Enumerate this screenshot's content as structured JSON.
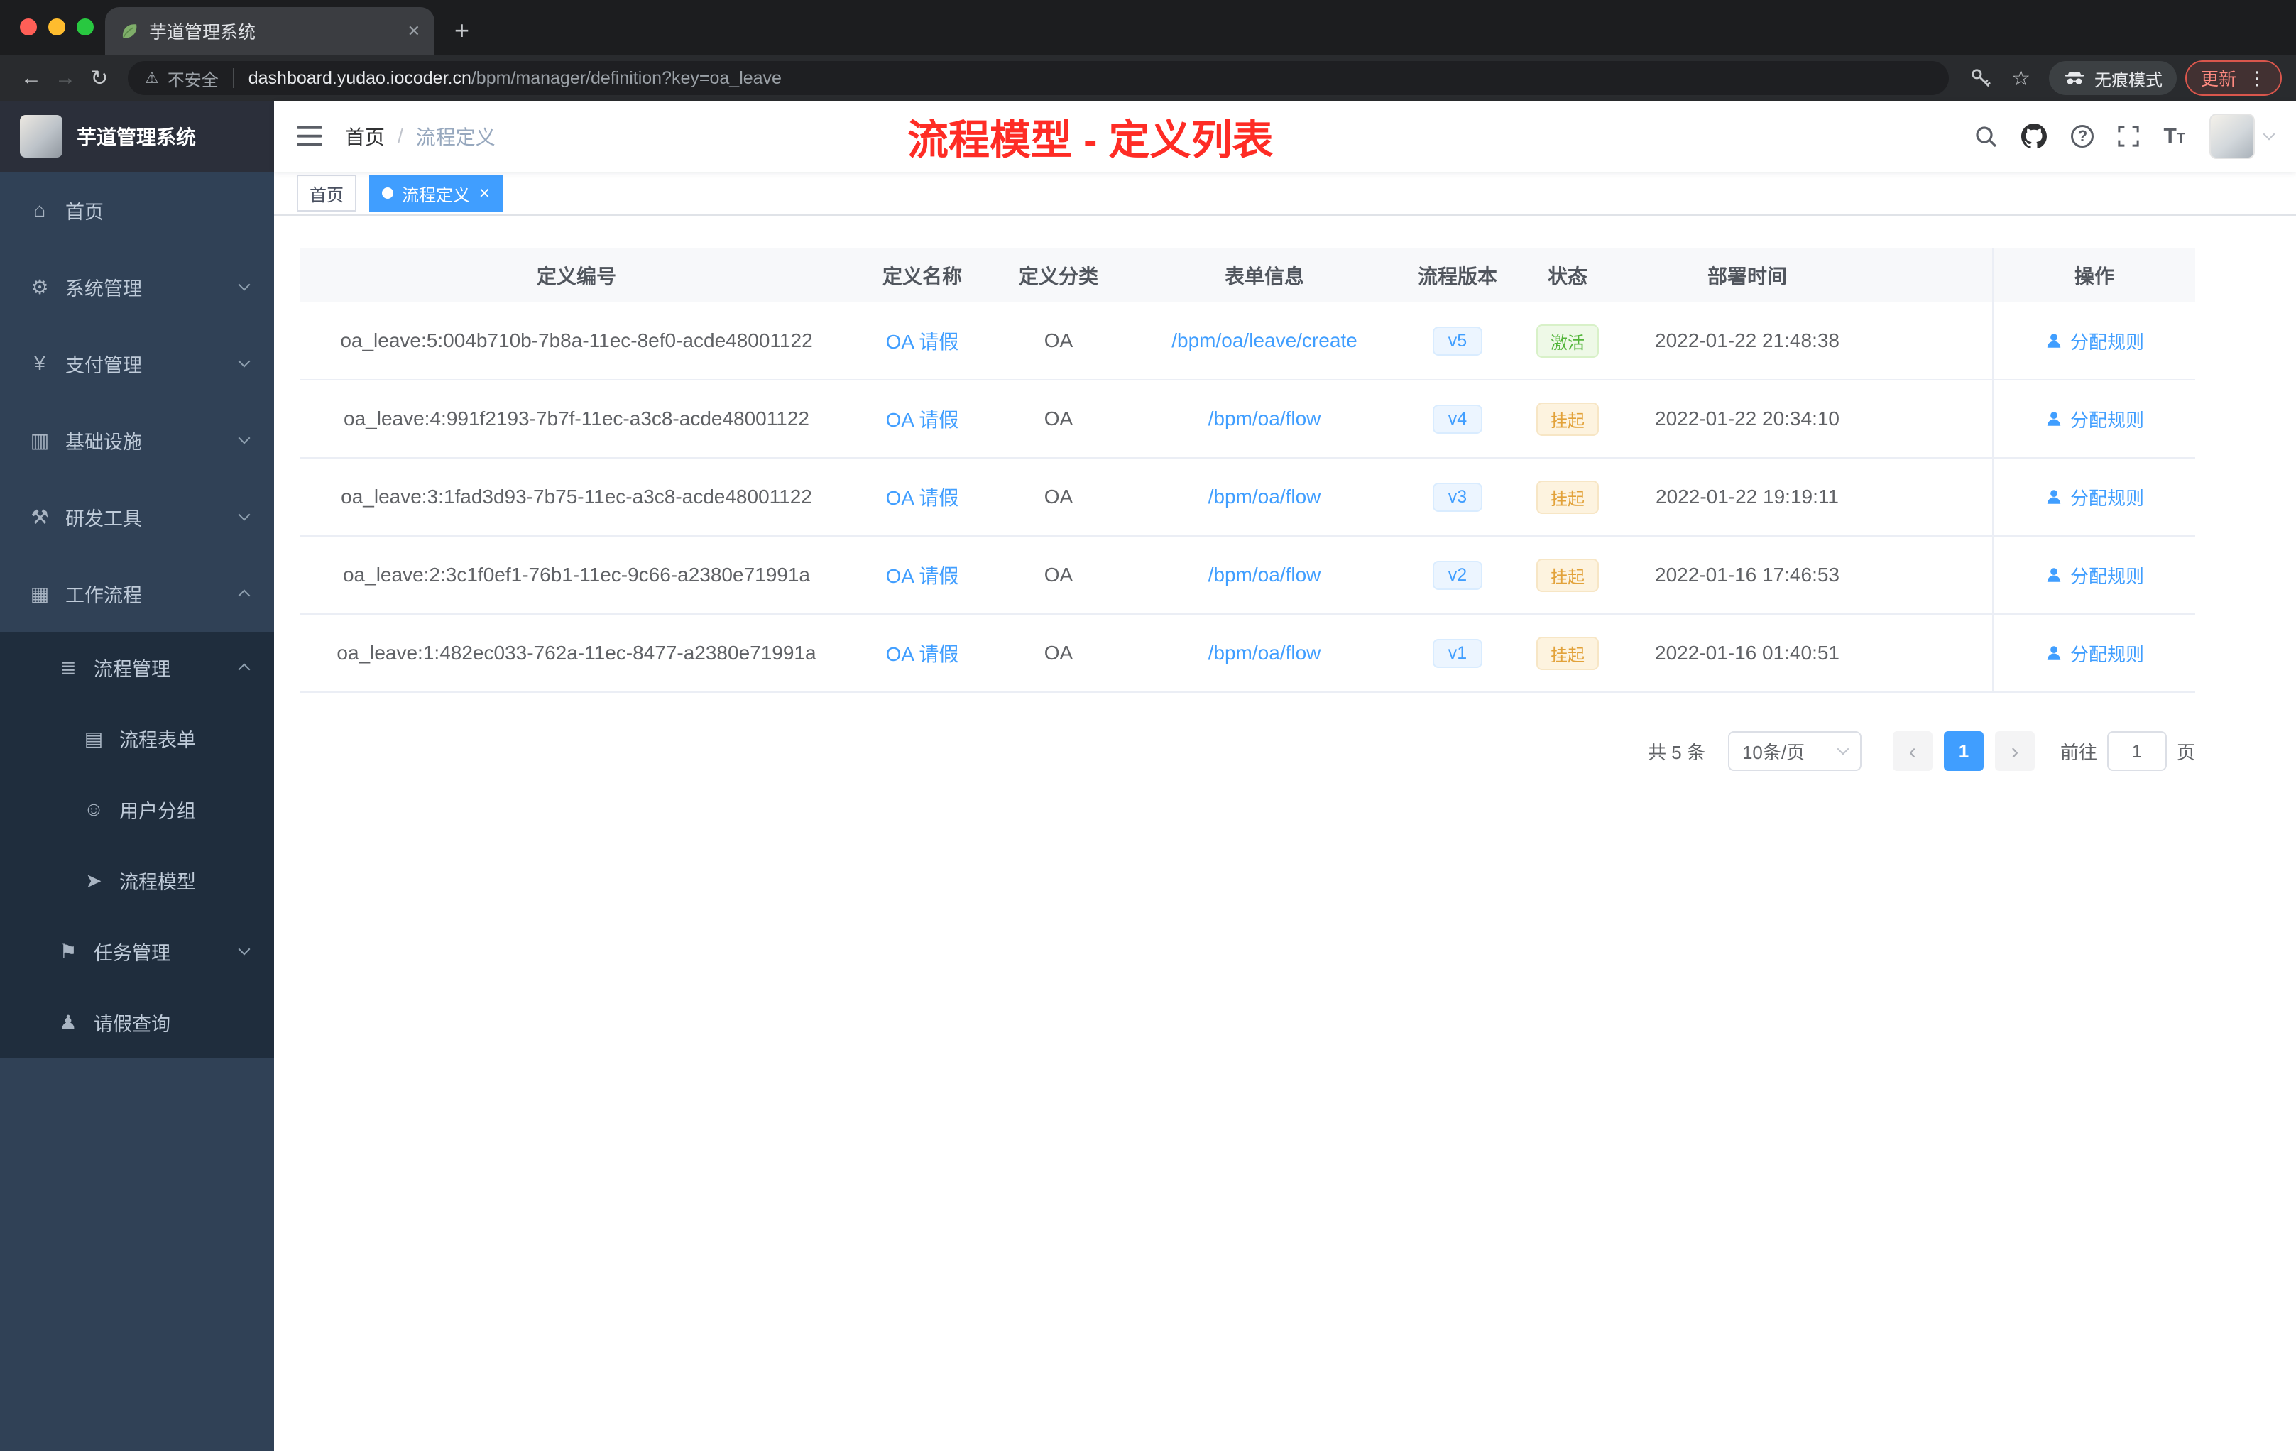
{
  "browser": {
    "tab_title": "芋道管理系统",
    "security_label": "不安全",
    "url_domain": "dashboard.yudao.iocoder.cn",
    "url_path": "/bpm/manager/definition?key=oa_leave",
    "incognito_label": "无痕模式",
    "update_label": "更新"
  },
  "icons": {
    "back": "←",
    "forward": "→",
    "reload": "↻",
    "warning": "⚠",
    "star": "☆",
    "menu_dots": "⋮",
    "new_tab": "+",
    "close": "✕",
    "help": "?",
    "font_large": "T",
    "font_small": "T"
  },
  "sidebar": {
    "logo_title": "芋道管理系统",
    "items": [
      {
        "label": "首页",
        "glyph": "⌂"
      },
      {
        "label": "系统管理",
        "glyph": "⚙"
      },
      {
        "label": "支付管理",
        "glyph": "¥"
      },
      {
        "label": "基础设施",
        "glyph": "▥"
      },
      {
        "label": "研发工具",
        "glyph": "⚒"
      },
      {
        "label": "工作流程",
        "glyph": "▦"
      },
      {
        "label": "流程管理",
        "glyph": "≣"
      },
      {
        "label": "流程表单",
        "glyph": "▤"
      },
      {
        "label": "用户分组",
        "glyph": "☺"
      },
      {
        "label": "流程模型",
        "glyph": "➤"
      },
      {
        "label": "任务管理",
        "glyph": "⚑"
      },
      {
        "label": "请假查询",
        "glyph": "♟"
      }
    ]
  },
  "navbar": {
    "breadcrumb_home": "首页",
    "breadcrumb_separator": "/",
    "breadcrumb_current": "流程定义",
    "annotation": "流程模型 - 定义列表"
  },
  "tags": {
    "items": [
      {
        "label": "首页"
      },
      {
        "label": "流程定义"
      }
    ]
  },
  "table": {
    "columns": [
      "定义编号",
      "定义名称",
      "定义分类",
      "表单信息",
      "流程版本",
      "状态",
      "部署时间",
      "操作"
    ],
    "rows": [
      {
        "id": "oa_leave:5:004b710b-7b8a-11ec-8ef0-acde48001122",
        "name": "OA 请假",
        "category": "OA",
        "form": "/bpm/oa/leave/create",
        "version": "v5",
        "status": "激活",
        "status_type": "active",
        "time": "2022-01-22 21:48:38",
        "action": "分配规则"
      },
      {
        "id": "oa_leave:4:991f2193-7b7f-11ec-a3c8-acde48001122",
        "name": "OA 请假",
        "category": "OA",
        "form": "/bpm/oa/flow",
        "version": "v4",
        "status": "挂起",
        "status_type": "suspended",
        "time": "2022-01-22 20:34:10",
        "action": "分配规则"
      },
      {
        "id": "oa_leave:3:1fad3d93-7b75-11ec-a3c8-acde48001122",
        "name": "OA 请假",
        "category": "OA",
        "form": "/bpm/oa/flow",
        "version": "v3",
        "status": "挂起",
        "status_type": "suspended",
        "time": "2022-01-22 19:19:11",
        "action": "分配规则"
      },
      {
        "id": "oa_leave:2:3c1f0ef1-76b1-11ec-9c66-a2380e71991a",
        "name": "OA 请假",
        "category": "OA",
        "form": "/bpm/oa/flow",
        "version": "v2",
        "status": "挂起",
        "status_type": "suspended",
        "time": "2022-01-16 17:46:53",
        "action": "分配规则"
      },
      {
        "id": "oa_leave:1:482ec033-762a-11ec-8477-a2380e71991a",
        "name": "OA 请假",
        "category": "OA",
        "form": "/bpm/oa/flow",
        "version": "v1",
        "status": "挂起",
        "status_type": "suspended",
        "time": "2022-01-16 01:40:51",
        "action": "分配规则"
      }
    ]
  },
  "pagination": {
    "total": "共 5 条",
    "page_size": "10条/页",
    "prev": "‹",
    "page": "1",
    "next": "›",
    "goto_label": "前往",
    "goto_value": "1",
    "unit": "页"
  },
  "colors": {
    "accent": "#409eff",
    "status_active": "#67c23a",
    "status_suspended": "#e6a23c",
    "annotation_red": "#fe2c25",
    "sidebar_bg": "#304156",
    "submenu_bg": "#1f2d3d"
  }
}
